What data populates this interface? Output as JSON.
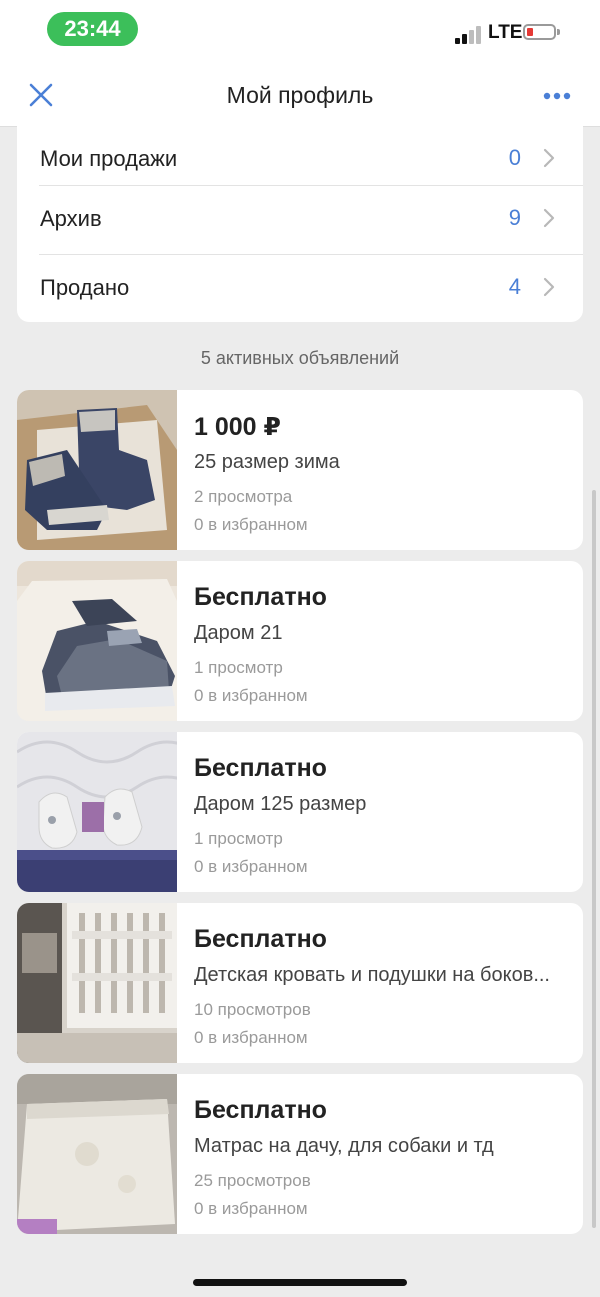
{
  "status_bar": {
    "time": "23:44",
    "network": "LTE"
  },
  "nav": {
    "title": "Мой профиль",
    "close_icon": "close-icon",
    "more_icon": "more-icon"
  },
  "accent_color": "#4a7fd6",
  "menu": [
    {
      "label": "Мои продажи",
      "count": "0"
    },
    {
      "label": "Архив",
      "count": "9"
    },
    {
      "label": "Продано",
      "count": "4"
    }
  ],
  "active_count_text": "5 активных объявлений",
  "listings": [
    {
      "price": "1 000 ₽",
      "title": "25 размер зима",
      "views": "2 просмотра",
      "favorites": "0 в избранном",
      "thumb_icon": "winter-boots-photo"
    },
    {
      "price": "Бесплатно",
      "title": "Даром 21",
      "views": "1 просмотр",
      "favorites": "0 в избранном",
      "thumb_icon": "sneakers-photo"
    },
    {
      "price": "Бесплатно",
      "title": "Даром 125 размер",
      "views": "1 просмотр",
      "favorites": "0 в избранном",
      "thumb_icon": "sandals-photo"
    },
    {
      "price": "Бесплатно",
      "title": "Детская кровать и подушки на боков...",
      "views": "10 просмотров",
      "favorites": "0 в избранном",
      "thumb_icon": "crib-photo"
    },
    {
      "price": "Бесплатно",
      "title": "Матрас на дачу, для собаки и тд",
      "views": "25 просмотров",
      "favorites": "0 в избранном",
      "thumb_icon": "mattress-photo"
    }
  ]
}
